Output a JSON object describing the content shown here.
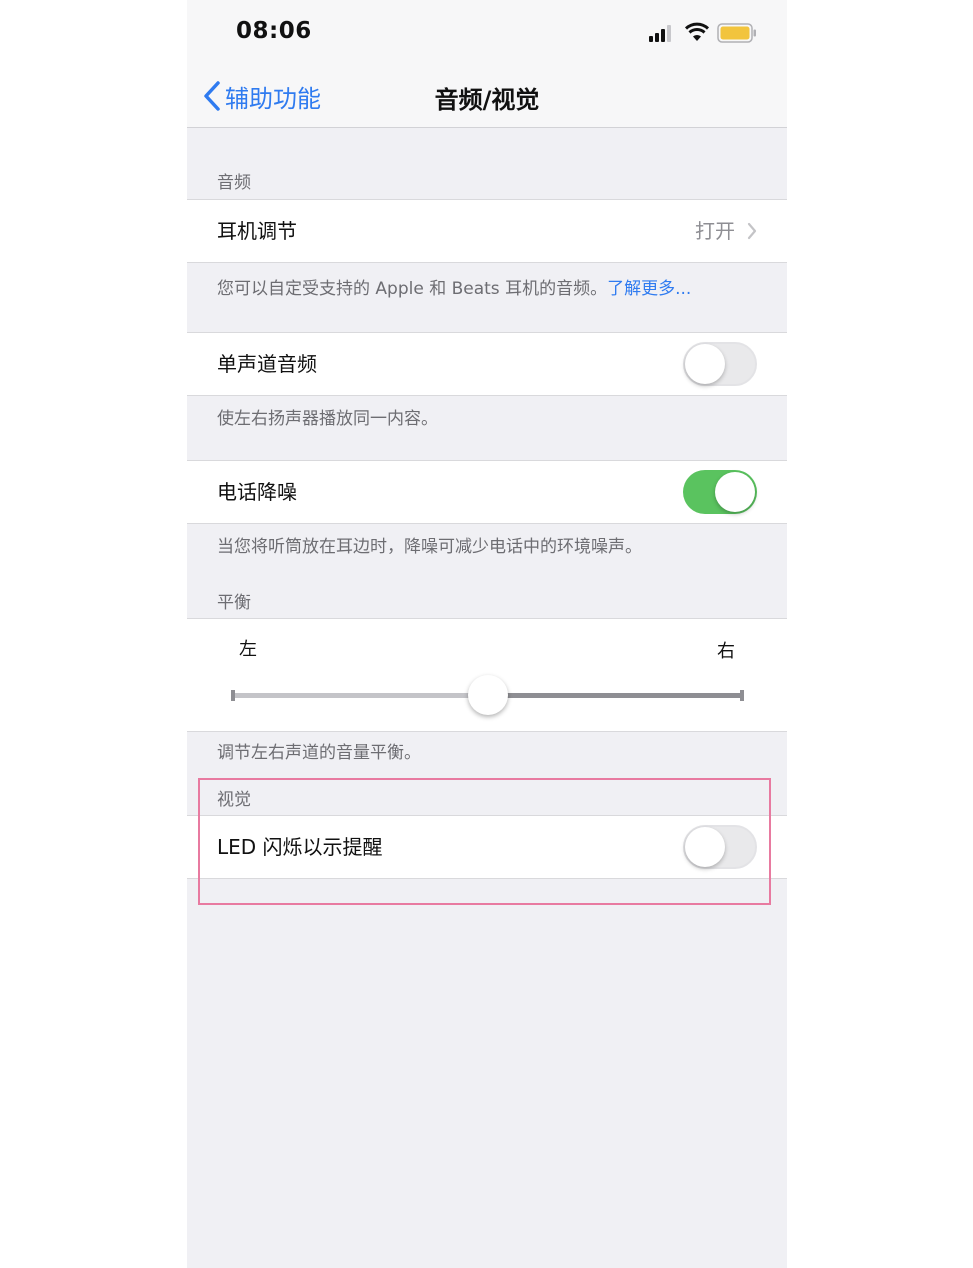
{
  "status_bar": {
    "time": "08:06"
  },
  "nav": {
    "back_label": "辅助功能",
    "title": "音频/视觉"
  },
  "audio_section": {
    "header": "音频",
    "headphone": {
      "label": "耳机调节",
      "value": "打开"
    },
    "headphone_footer": "您可以自定受支持的 Apple 和 Beats 耳机的音频。",
    "headphone_footer_link": "了解更多...",
    "mono": {
      "label": "单声道音频",
      "on": false
    },
    "mono_footer": "使左右扬声器播放同一内容。",
    "noise": {
      "label": "电话降噪",
      "on": true
    },
    "noise_footer": "当您将听筒放在耳边时，降噪可减少电话中的环境噪声。"
  },
  "balance_section": {
    "header": "平衡",
    "left_label": "左",
    "right_label": "右",
    "value": 0.5,
    "footer": "调节左右声道的音量平衡。"
  },
  "visual_section": {
    "header": "视觉",
    "led": {
      "label": "LED 闪烁以示提醒",
      "on": false
    }
  },
  "colors": {
    "accent": "#2f7bf0",
    "switch_on": "#5ac35f",
    "highlight": "#e87aa0"
  }
}
